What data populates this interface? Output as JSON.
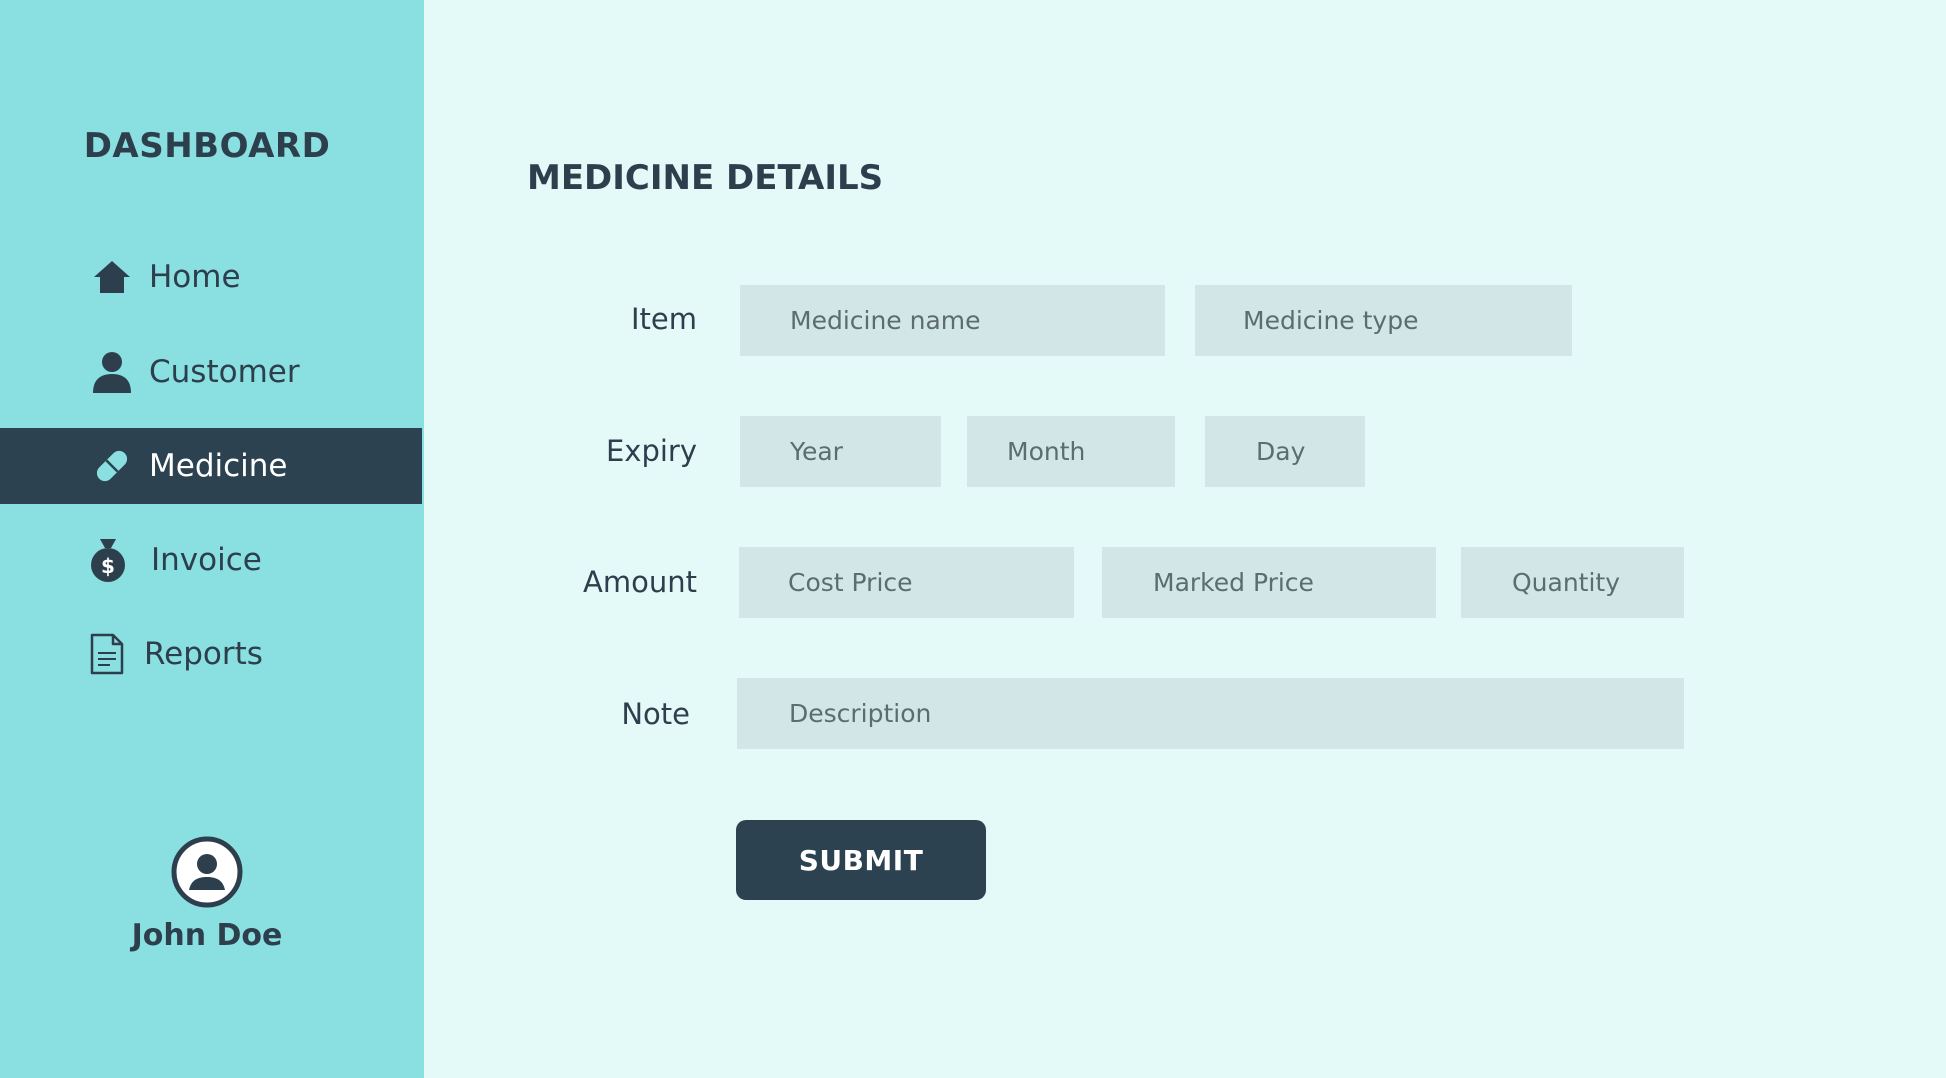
{
  "sidebar": {
    "brand": "DASHBOARD",
    "items": [
      {
        "label": "Home",
        "icon": "home-icon"
      },
      {
        "label": "Customer",
        "icon": "person-icon"
      },
      {
        "label": "Medicine",
        "icon": "pill-icon",
        "active": true
      },
      {
        "label": "Invoice",
        "icon": "money-bag-icon"
      },
      {
        "label": "Reports",
        "icon": "document-icon"
      }
    ],
    "user": {
      "name": "John Doe",
      "icon": "user-avatar-icon"
    }
  },
  "main": {
    "title": "MEDICINE DETAILS",
    "rows": {
      "item": {
        "label": "Item",
        "fields": {
          "medicine_name": "Medicine name",
          "medicine_type": "Medicine type"
        }
      },
      "expiry": {
        "label": "Expiry",
        "fields": {
          "year": "Year",
          "month": "Month",
          "day": "Day"
        }
      },
      "amount": {
        "label": "Amount",
        "fields": {
          "cost_price": "Cost Price",
          "marked_price": "Marked Price",
          "quantity": "Quantity"
        }
      },
      "note": {
        "label": "Note",
        "fields": {
          "description": "Description"
        }
      }
    },
    "submit_label": "SUBMIT"
  },
  "colors": {
    "sidebar_bg": "#8adfe1",
    "main_bg": "#e3faf8",
    "accent_dark": "#2d4250",
    "field_bg": "#d2e6e7"
  }
}
